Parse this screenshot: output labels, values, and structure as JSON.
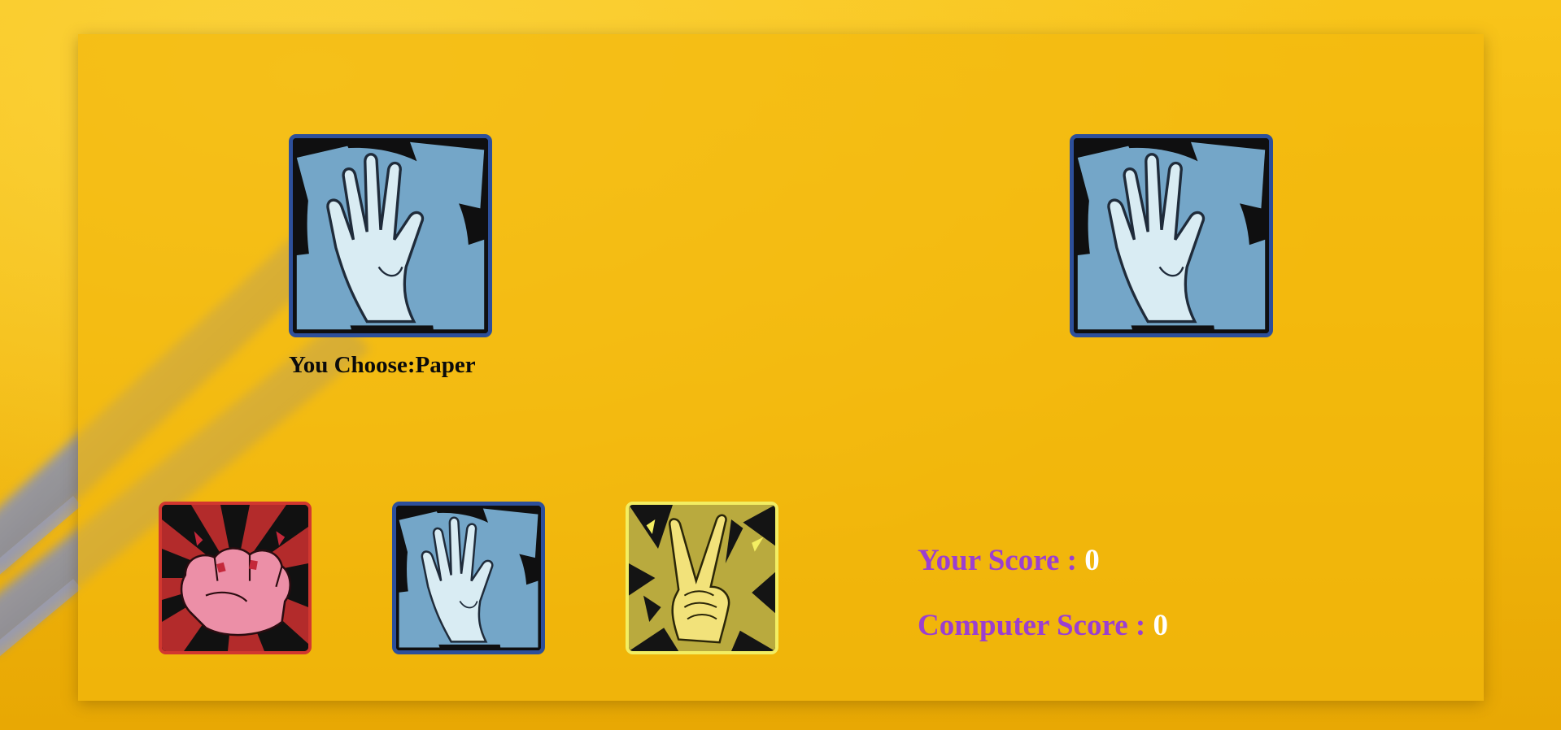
{
  "player": {
    "choice_label": "You Choose:",
    "choice_value": "Paper"
  },
  "scores": {
    "your_label": "Your Score : ",
    "your_value": "0",
    "computer_label": "Computer Score : ",
    "computer_value": "0"
  },
  "choices": [
    {
      "name": "rock",
      "icon": "fist-icon",
      "border_color": "#d2372f"
    },
    {
      "name": "paper",
      "icon": "open-hand-icon",
      "border_color": "#2d4f9a"
    },
    {
      "name": "scissors",
      "icon": "peace-sign-icon",
      "border_color": "#f3ee62"
    }
  ],
  "computer": {
    "icon": "open-hand-icon"
  },
  "colors": {
    "background": "#f5bb10",
    "score_label": "#9b3fd0",
    "score_value": "#ffffff",
    "choice_text": "#0b0b0b"
  }
}
